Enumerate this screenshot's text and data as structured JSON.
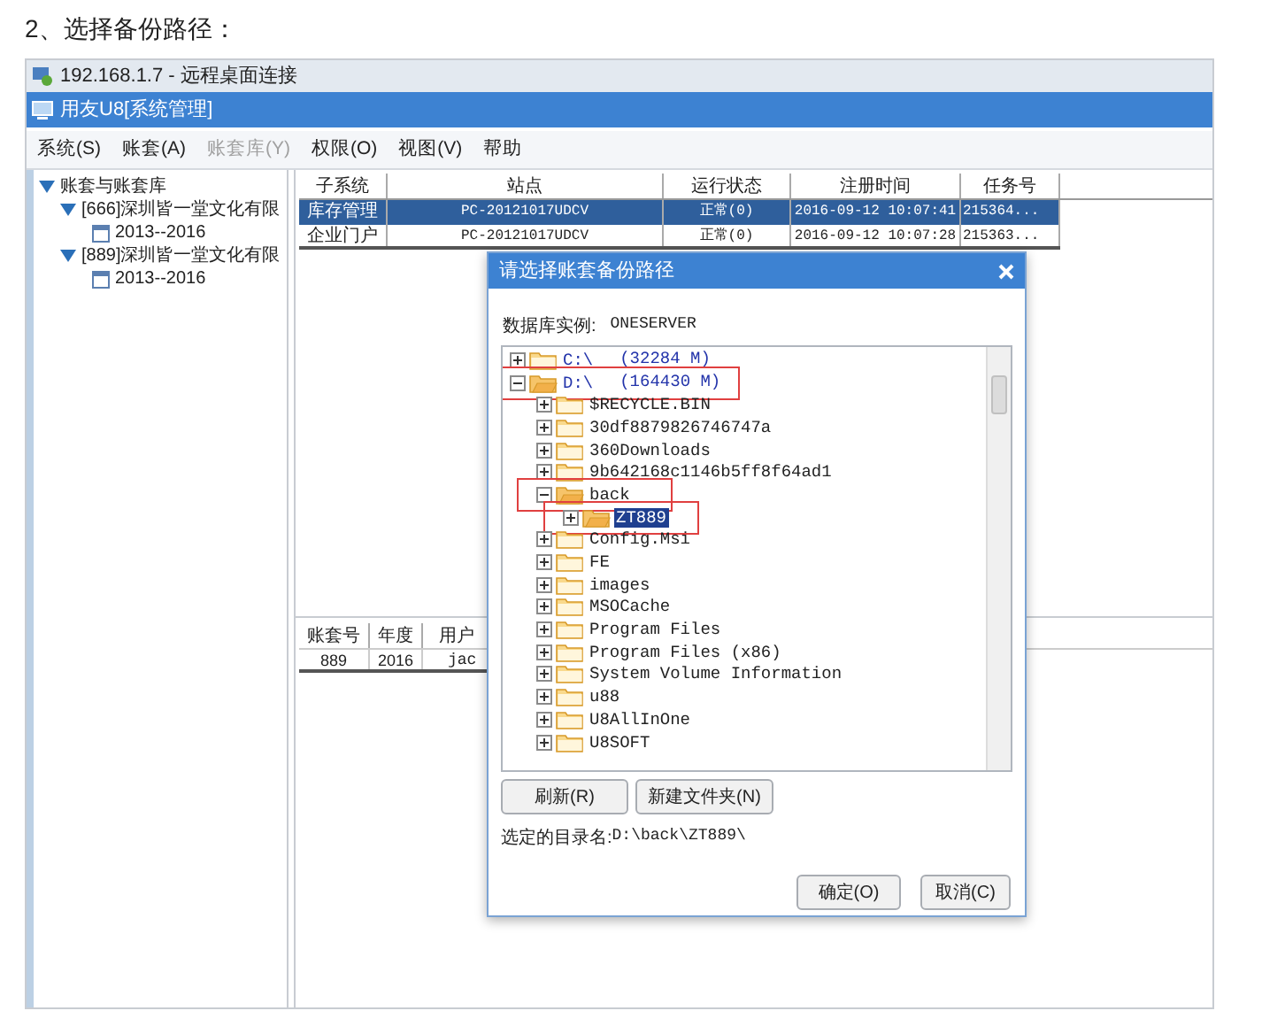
{
  "heading": "2、选择备份路径：",
  "remote_window": {
    "title": "192.168.1.7 - 远程桌面连接"
  },
  "app": {
    "title": "用友U8[系统管理]"
  },
  "menu": [
    {
      "label": "系统(S)",
      "disabled": false
    },
    {
      "label": "账套(A)",
      "disabled": false
    },
    {
      "label": "账套库(Y)",
      "disabled": true
    },
    {
      "label": "权限(O)",
      "disabled": false
    },
    {
      "label": "视图(V)",
      "disabled": false
    },
    {
      "label": "帮助",
      "disabled": false
    }
  ],
  "account_tree": [
    {
      "label": "账套与账套库",
      "kind": "group",
      "expanded": true,
      "children": [
        {
          "label": "[666]深圳皆一堂文化有限",
          "kind": "group",
          "expanded": true,
          "children": [
            {
              "label": "2013--2016",
              "kind": "year"
            }
          ]
        },
        {
          "label": "[889]深圳皆一堂文化有限",
          "kind": "group",
          "expanded": true,
          "children": [
            {
              "label": "2013--2016",
              "kind": "year"
            }
          ]
        }
      ]
    }
  ],
  "sessions_table": {
    "columns": [
      "子系统",
      "站点",
      "运行状态",
      "注册时间",
      "任务号"
    ],
    "rows": [
      {
        "cells": [
          "库存管理",
          "PC-20121017UDCV",
          "正常(0)",
          "2016-09-12 10:07:41",
          "215364..."
        ],
        "selected": true
      },
      {
        "cells": [
          "企业门户",
          "PC-20121017UDCV",
          "正常(0)",
          "2016-09-12 10:07:28",
          "215363..."
        ],
        "selected": false
      }
    ]
  },
  "accounts_table": {
    "columns": [
      "账套号",
      "年度",
      "用户"
    ],
    "rows": [
      {
        "cells": [
          "889",
          "2016",
          "jac"
        ]
      }
    ]
  },
  "dialog": {
    "title": "请选择账套备份路径",
    "instance_label": "数据库实例:",
    "instance": "ONESERVER",
    "tree": [
      {
        "label": "C:\\",
        "size": "(32284 M)",
        "kind": "drive",
        "expanded": false,
        "selected": false,
        "highlighted": false
      },
      {
        "label": "D:\\",
        "size": "(164430 M)",
        "kind": "drive",
        "expanded": true,
        "selected": false,
        "highlighted": true,
        "children": [
          {
            "label": "$RECYCLE.BIN",
            "kind": "folder",
            "expanded": false,
            "selected": false,
            "highlighted": false
          },
          {
            "label": "30df8879826746747a",
            "kind": "folder",
            "expanded": false,
            "selected": false,
            "highlighted": false
          },
          {
            "label": "360Downloads",
            "kind": "folder",
            "expanded": false,
            "selected": false,
            "highlighted": false
          },
          {
            "label": "9b642168c1146b5ff8f64ad1",
            "kind": "folder",
            "expanded": false,
            "selected": false,
            "highlighted": false
          },
          {
            "label": "back",
            "kind": "folder",
            "expanded": true,
            "selected": false,
            "highlighted": true,
            "children": [
              {
                "label": "ZT889",
                "kind": "folder",
                "expanded": false,
                "selected": true,
                "highlighted": true
              }
            ]
          },
          {
            "label": "Config.Msi",
            "kind": "folder",
            "expanded": false,
            "selected": false,
            "highlighted": false
          },
          {
            "label": "FE",
            "kind": "folder",
            "expanded": false,
            "selected": false,
            "highlighted": false
          },
          {
            "label": "images",
            "kind": "folder",
            "expanded": false,
            "selected": false,
            "highlighted": false
          },
          {
            "label": "MSOCache",
            "kind": "folder",
            "expanded": false,
            "selected": false,
            "highlighted": false
          },
          {
            "label": "Program Files",
            "kind": "folder",
            "expanded": false,
            "selected": false,
            "highlighted": false
          },
          {
            "label": "Program Files (x86)",
            "kind": "folder",
            "expanded": false,
            "selected": false,
            "highlighted": false
          },
          {
            "label": "System Volume Information",
            "kind": "folder",
            "expanded": false,
            "selected": false,
            "highlighted": false
          },
          {
            "label": "u88",
            "kind": "folder",
            "expanded": false,
            "selected": false,
            "highlighted": false
          },
          {
            "label": "U8AllInOne",
            "kind": "folder",
            "expanded": false,
            "selected": false,
            "highlighted": false
          },
          {
            "label": "U8SOFT",
            "kind": "folder",
            "expanded": false,
            "selected": false,
            "highlighted": false
          }
        ]
      }
    ],
    "tool_buttons": [
      "刷新(R)",
      "新建文件夹(N)"
    ],
    "selected_path_label": "选定的目录名:",
    "selected_path": "D:\\back\\ZT889\\",
    "actions": [
      "确定(O)",
      "取消(C)"
    ]
  }
}
